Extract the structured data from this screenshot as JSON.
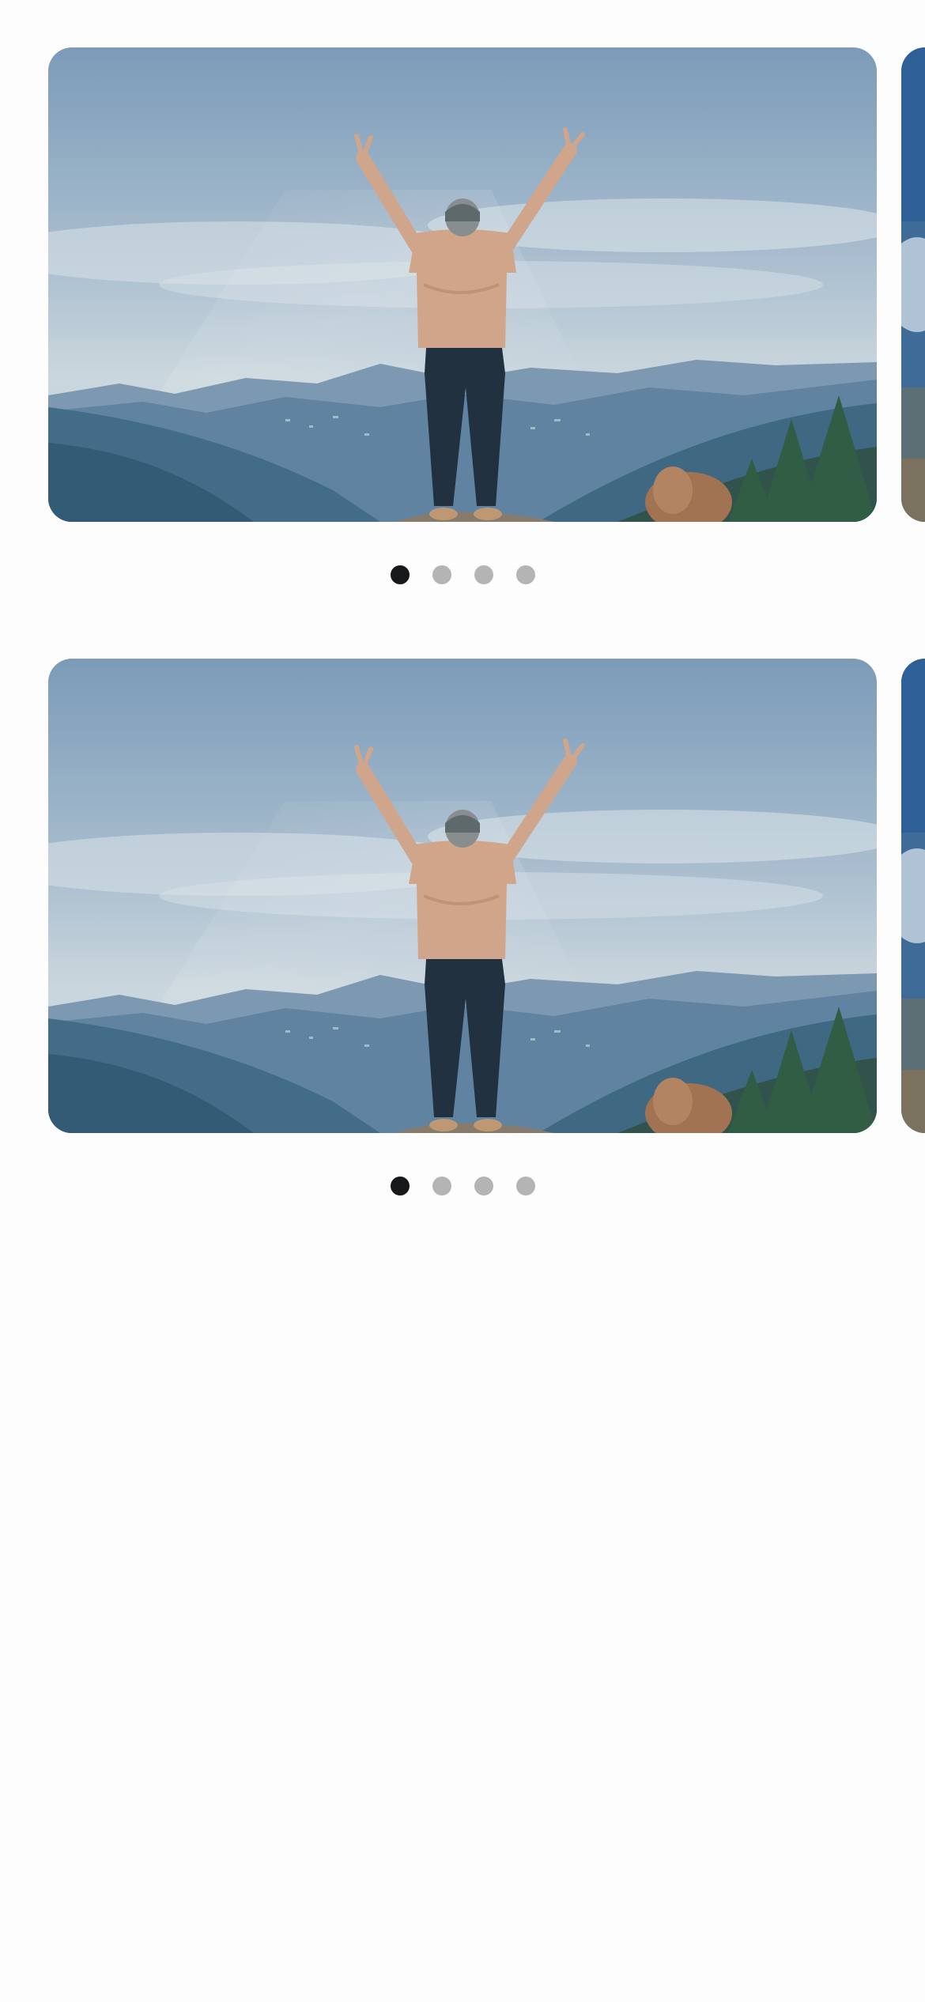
{
  "carousels": [
    {
      "slides": [
        {
          "image": "person-arms-raised-mountain-view"
        },
        {
          "image": "partially-visible-next-slide"
        }
      ],
      "indicator": {
        "count": 4,
        "active_index": 0,
        "active_color": "#17181a",
        "inactive_color": "#b4b4b4"
      }
    },
    {
      "slides": [
        {
          "image": "person-arms-raised-mountain-view"
        },
        {
          "image": "partially-visible-next-slide"
        }
      ],
      "indicator": {
        "count": 4,
        "active_index": 0,
        "active_color": "#17181a",
        "inactive_color": "#b4b4b4"
      }
    }
  ],
  "colors": {
    "background": "#fdfdfd",
    "sky_top": "#7fa0bd",
    "sky_mid": "#b3c7d6",
    "haze": "#d6e0e4",
    "mountain_far": "#6f8eaa",
    "mountain_near": "#3d6684",
    "forest": "#2f5a40",
    "shirt": "#d9a888",
    "pants": "#1b2a38"
  }
}
